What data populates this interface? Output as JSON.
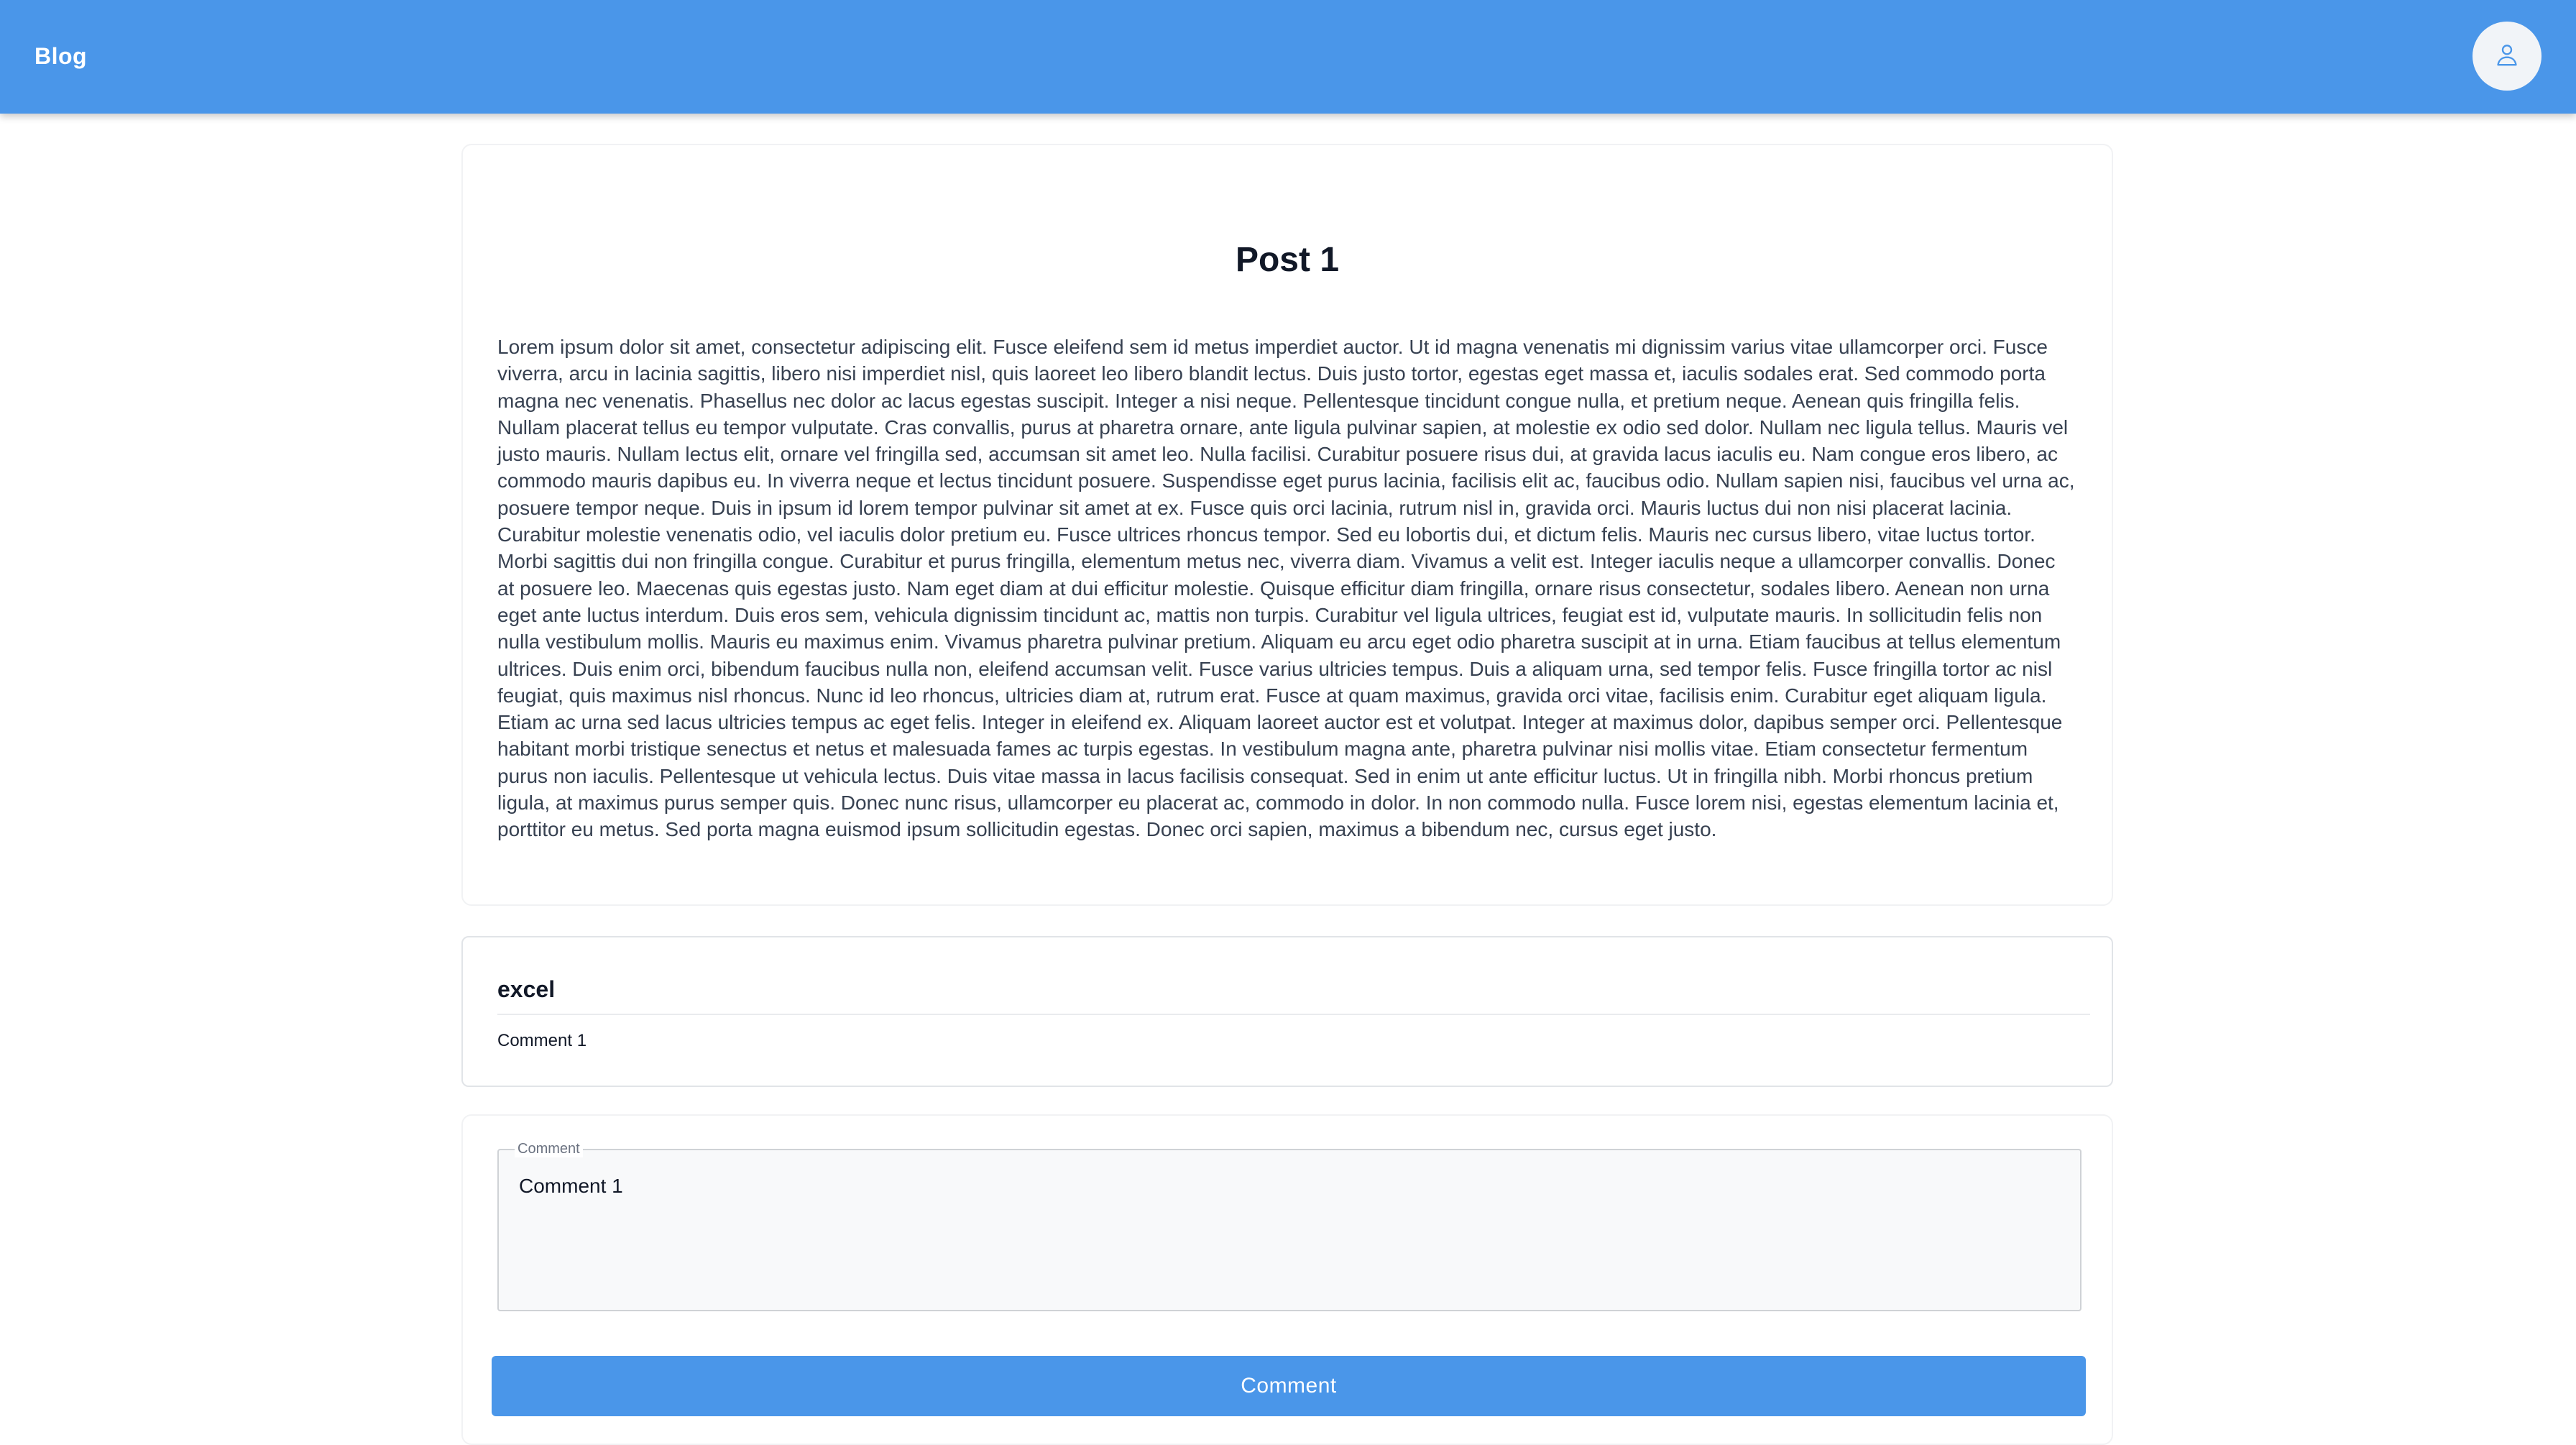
{
  "header": {
    "brand": "Blog",
    "avatar_icon": "user-icon",
    "background_color": "#4a96e9"
  },
  "post": {
    "title": "Post 1",
    "body": "Lorem ipsum dolor sit amet, consectetur adipiscing elit. Fusce eleifend sem id metus imperdiet auctor. Ut id magna venenatis mi dignissim varius vitae ullamcorper orci. Fusce viverra, arcu in lacinia sagittis, libero nisi imperdiet nisl, quis laoreet leo libero blandit lectus. Duis justo tortor, egestas eget massa et, iaculis sodales erat. Sed commodo porta magna nec venenatis. Phasellus nec dolor ac lacus egestas suscipit. Integer a nisi neque. Pellentesque tincidunt congue nulla, et pretium neque. Aenean quis fringilla felis. Nullam placerat tellus eu tempor vulputate. Cras convallis, purus at pharetra ornare, ante ligula pulvinar sapien, at molestie ex odio sed dolor. Nullam nec ligula tellus. Mauris vel justo mauris. Nullam lectus elit, ornare vel fringilla sed, accumsan sit amet leo. Nulla facilisi. Curabitur posuere risus dui, at gravida lacus iaculis eu. Nam congue eros libero, ac commodo mauris dapibus eu. In viverra neque et lectus tincidunt posuere. Suspendisse eget purus lacinia, facilisis elit ac, faucibus odio. Nullam sapien nisi, faucibus vel urna ac, posuere tempor neque. Duis in ipsum id lorem tempor pulvinar sit amet at ex. Fusce quis orci lacinia, rutrum nisl in, gravida orci. Mauris luctus dui non nisi placerat lacinia. Curabitur molestie venenatis odio, vel iaculis dolor pretium eu. Fusce ultrices rhoncus tempor. Sed eu lobortis dui, et dictum felis. Mauris nec cursus libero, vitae luctus tortor. Morbi sagittis dui non fringilla congue. Curabitur et purus fringilla, elementum metus nec, viverra diam. Vivamus a velit est. Integer iaculis neque a ullamcorper convallis. Donec at posuere leo. Maecenas quis egestas justo. Nam eget diam at dui efficitur molestie. Quisque efficitur diam fringilla, ornare risus consectetur, sodales libero. Aenean non urna eget ante luctus interdum. Duis eros sem, vehicula dignissim tincidunt ac, mattis non turpis. Curabitur vel ligula ultrices, feugiat est id, vulputate mauris. In sollicitudin felis non nulla vestibulum mollis. Mauris eu maximus enim. Vivamus pharetra pulvinar pretium. Aliquam eu arcu eget odio pharetra suscipit at in urna. Etiam faucibus at tellus elementum ultrices. Duis enim orci, bibendum faucibus nulla non, eleifend accumsan velit. Fusce varius ultricies tempus. Duis a aliquam urna, sed tempor felis. Fusce fringilla tortor ac nisl feugiat, quis maximus nisl rhoncus. Nunc id leo rhoncus, ultricies diam at, rutrum erat. Fusce at quam maximus, gravida orci vitae, facilisis enim. Curabitur eget aliquam ligula. Etiam ac urna sed lacus ultricies tempus ac eget felis. Integer in eleifend ex. Aliquam laoreet auctor est et volutpat. Integer at maximus dolor, dapibus semper orci. Pellentesque habitant morbi tristique senectus et netus et malesuada fames ac turpis egestas. In vestibulum magna ante, pharetra pulvinar nisi mollis vitae. Etiam consectetur fermentum purus non iaculis. Pellentesque ut vehicula lectus. Duis vitae massa in lacus facilisis consequat. Sed in enim ut ante efficitur luctus. Ut in fringilla nibh. Morbi rhoncus pretium ligula, at maximus purus semper quis. Donec nunc risus, ullamcorper eu placerat ac, commodo in dolor. In non commodo nulla. Fusce lorem nisi, egestas elementum lacinia et, porttitor eu metus. Sed porta magna euismod ipsum sollicitudin egestas. Donec orci sapien, maximus a bibendum nec, cursus eget justo."
  },
  "comments": [
    {
      "author": "excel",
      "text": "Comment 1"
    }
  ],
  "comment_form": {
    "label": "Comment",
    "value": "Comment 1",
    "submit_label": "Comment",
    "button_color": "#4a96e9"
  }
}
